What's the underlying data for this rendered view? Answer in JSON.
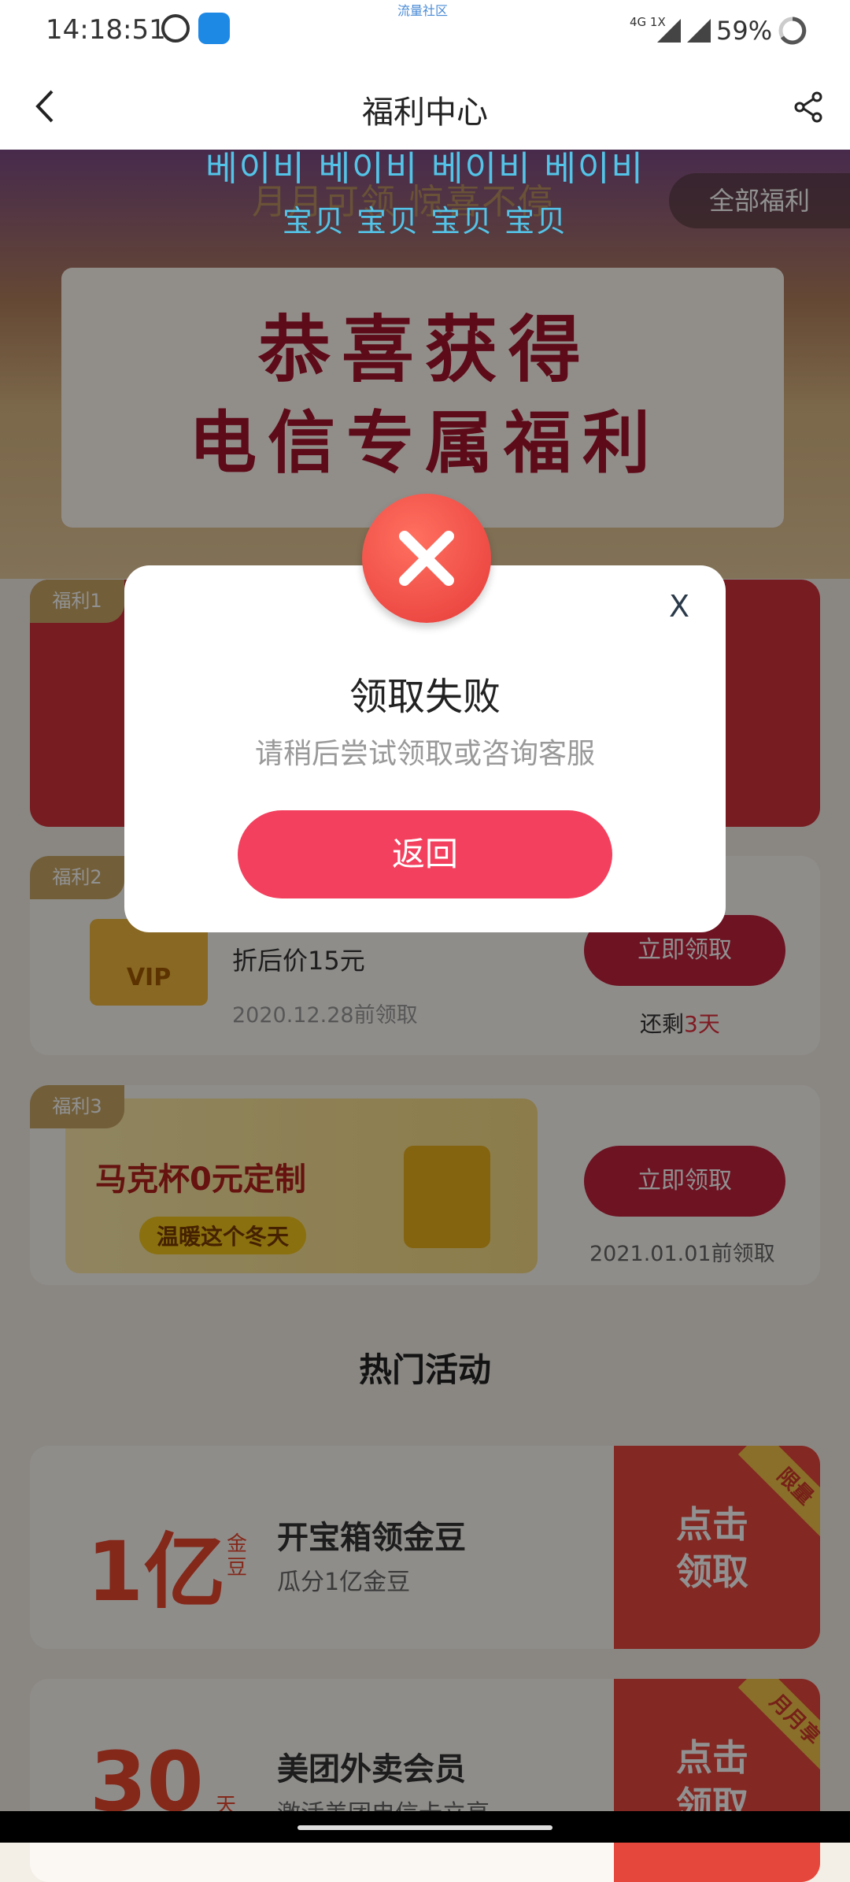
{
  "status_bar": {
    "time": "14:18:51",
    "top_mark": "流量社区",
    "network": "4G 1X",
    "battery_percent": "59%"
  },
  "nav": {
    "title": "福利中心"
  },
  "banner": {
    "tagline": "月月可领  惊喜不停",
    "all_benefits": "全部福利",
    "headline_line1": "恭喜获得",
    "headline_line2": "电信专属福利"
  },
  "watermark": {
    "line1": "베이비 베이비 베이비 베이비",
    "line2": "宝贝 宝贝 宝贝 宝贝"
  },
  "benefits": [
    {
      "tag": "福利1"
    },
    {
      "tag": "福利2",
      "image_label": "VIP",
      "price": "折后价15元",
      "deadline": "2020.12.28前领取",
      "button": "立即领取",
      "remaining_prefix": "还剩",
      "remaining_value": "3天"
    },
    {
      "tag": "福利3",
      "promo_line1": "马克杯0元定制",
      "promo_line2": "温暖这个冬天",
      "button": "立即领取",
      "deadline": "2021.01.01前领取"
    }
  ],
  "hot_section": {
    "title": "热门活动",
    "items": [
      {
        "amount": "1亿",
        "unit": "金豆",
        "title": "开宝箱领金豆",
        "subtitle": "瓜分1亿金豆",
        "cta": "点击领取",
        "ribbon": "限量"
      },
      {
        "amount": "30",
        "unit": "天",
        "title": "美团外卖会员",
        "subtitle": "激活美团电信卡立享",
        "cta": "点击领取",
        "ribbon": "月月享"
      }
    ]
  },
  "dialog": {
    "close": "X",
    "title": "领取失败",
    "message": "请稍后尝试领取或咨询客服",
    "button": "返回"
  },
  "colors": {
    "accent_red": "#f3405e",
    "button_red": "#c0223d",
    "gold": "#c9a766"
  }
}
